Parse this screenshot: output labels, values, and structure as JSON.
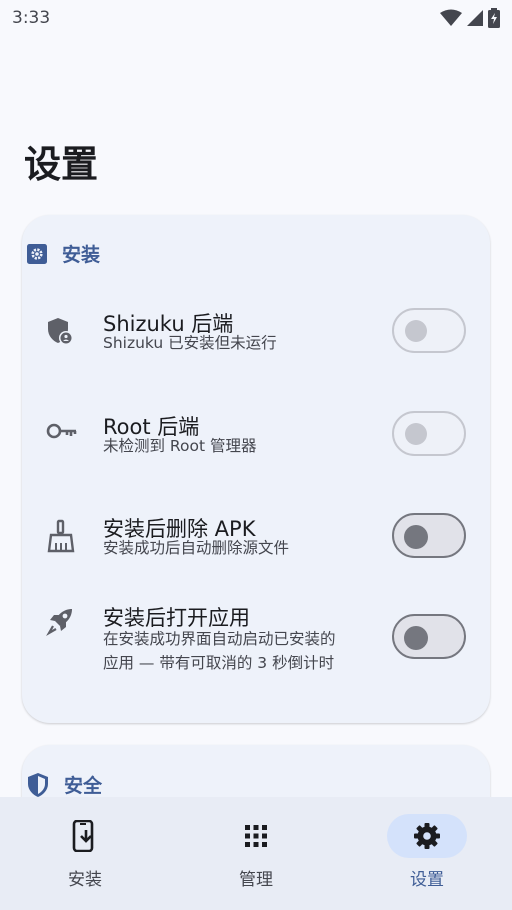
{
  "status_bar": {
    "time": "3:33",
    "icons": [
      "wifi-icon",
      "signal-icon",
      "battery-charging-icon"
    ]
  },
  "page": {
    "title": "设置"
  },
  "install_section": {
    "header": "安装",
    "header_icon": "settings-square-icon",
    "items": [
      {
        "title": "Shizuku 后端",
        "subtitle": "Shizuku 已安装但未运行",
        "icon": "shield-user-icon",
        "enabled": false
      },
      {
        "title": "Root 后端",
        "subtitle": "未检测到 Root 管理器",
        "icon": "key-icon",
        "enabled": false
      },
      {
        "title": "安装后删除 APK",
        "subtitle": "安装成功后自动删除源文件",
        "icon": "broom-icon",
        "checked": false
      },
      {
        "title": "安装后打开应用",
        "subtitle_lines": [
          "在安装成功界面自动启动已安装的",
          "应用 — 带有可取消的 3 秒倒计时"
        ],
        "icon": "rocket-icon",
        "checked": false
      }
    ]
  },
  "security_section": {
    "header": "安全",
    "header_icon": "shield-icon"
  },
  "bottom_nav": {
    "items": [
      {
        "label": "安装",
        "icon": "install-phone-icon",
        "active": false
      },
      {
        "label": "管理",
        "icon": "apps-grid-icon",
        "active": false
      },
      {
        "label": "设置",
        "icon": "gear-icon",
        "active": true
      }
    ]
  },
  "colors": {
    "accent": "#3f5d96",
    "card": "#eef2fa",
    "background": "#f8f9fd",
    "nav_active": "#d4e2fb"
  }
}
